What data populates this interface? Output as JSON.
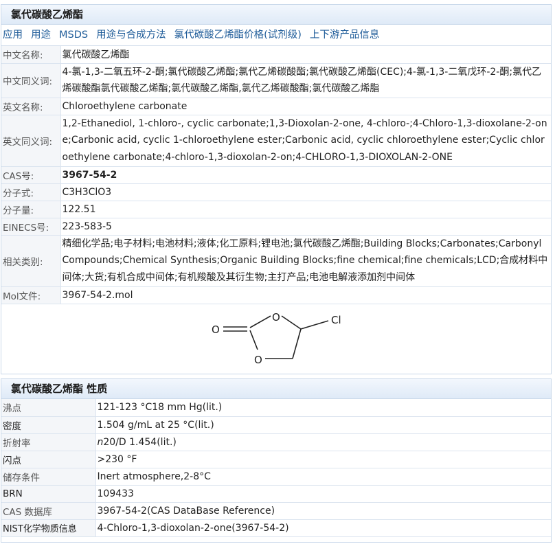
{
  "section1": {
    "title": "氯代碳酸乙烯酯",
    "tabs": [
      "应用",
      "用途",
      "MSDS",
      "用途与合成方法",
      "氯代碳酸乙烯酯价格(试剂级)",
      "上下游产品信息"
    ],
    "rows": {
      "cn_name": {
        "label": "中文名称:",
        "value": "氯代碳酸乙烯酯"
      },
      "cn_syn": {
        "label": "中文同义词:",
        "value": "4-氯-1,3-二氧五环-2-酮;氯代碳酸乙烯酯;氯代乙烯碳酸酯;氯代碳酸乙烯酯(CEC);4-氯-1,3-二氧戊环-2-酮;氯代乙烯碳酸酯氯代碳酸乙烯酯;氯代碳酸乙烯酯,氯代乙烯碳酸酯;氯代碳酸乙烯脂"
      },
      "en_name": {
        "label": "英文名称:",
        "value": "Chloroethylene carbonate"
      },
      "en_syn": {
        "label": "英文同义词:",
        "value": "1,2-Ethanediol, 1-chloro-, cyclic carbonate;1,3-Dioxolan-2-one, 4-chloro-;4-Chloro-1,3-dioxolane-2-one;Carbonic acid, cyclic 1-chloroethylene ester;Carbonic acid, cyclic chloroethylene ester;Cyclic chloroethylene carbonate;4-chloro-1,3-dioxolan-2-on;4-CHLORO-1,3-DIOXOLAN-2-ONE"
      },
      "cas": {
        "label": "CAS号:",
        "value": "3967-54-2"
      },
      "formula": {
        "label": "分子式:",
        "value": "C3H3ClO3"
      },
      "mw": {
        "label": "分子量:",
        "value": "122.51"
      },
      "einecs": {
        "label": "EINECS号:",
        "value": "223-583-5"
      },
      "category": {
        "label": "相关类别:",
        "value": "精细化学品;电子材料;电池材料;液体;化工原料;锂电池;氯代碳酸乙烯酯;Building Blocks;Carbonates;Carbonyl Compounds;Chemical Synthesis;Organic Building Blocks;fine chemical;fine chemicals;LCD;合成材料中间体;大货;有机合成中间体;有机羧酸及其衍生物;主打产品;电池电解液添加剂中间体"
      },
      "mol": {
        "label": "Mol文件:",
        "value": "3967-54-2.mol"
      }
    },
    "structure_atoms": {
      "o_carbonyl": "O",
      "o_top": "O",
      "o_bottom": "O",
      "cl": "Cl"
    }
  },
  "section2": {
    "title": "氯代碳酸乙烯酯 性质",
    "rows": [
      {
        "label": "沸点",
        "value": "121-123 °C18 mm Hg(lit.)"
      },
      {
        "label": "密度",
        "value": "1.504 g/mL at 25 °C(lit.)"
      },
      {
        "label": "折射率",
        "value_italic": "n",
        "value": "20/D 1.454(lit.)"
      },
      {
        "label": "闪点",
        "value": ">230 °F"
      },
      {
        "label": "储存条件",
        "value": "Inert atmosphere,2-8°C"
      },
      {
        "label": "BRN",
        "value": "109433"
      },
      {
        "label": "CAS 数据库",
        "value": "3967-54-2(CAS DataBase Reference)"
      },
      {
        "label": "NIST化学物质信息",
        "value": "4-Chloro-1,3-dioxolan-2-one(3967-54-2)"
      }
    ]
  }
}
